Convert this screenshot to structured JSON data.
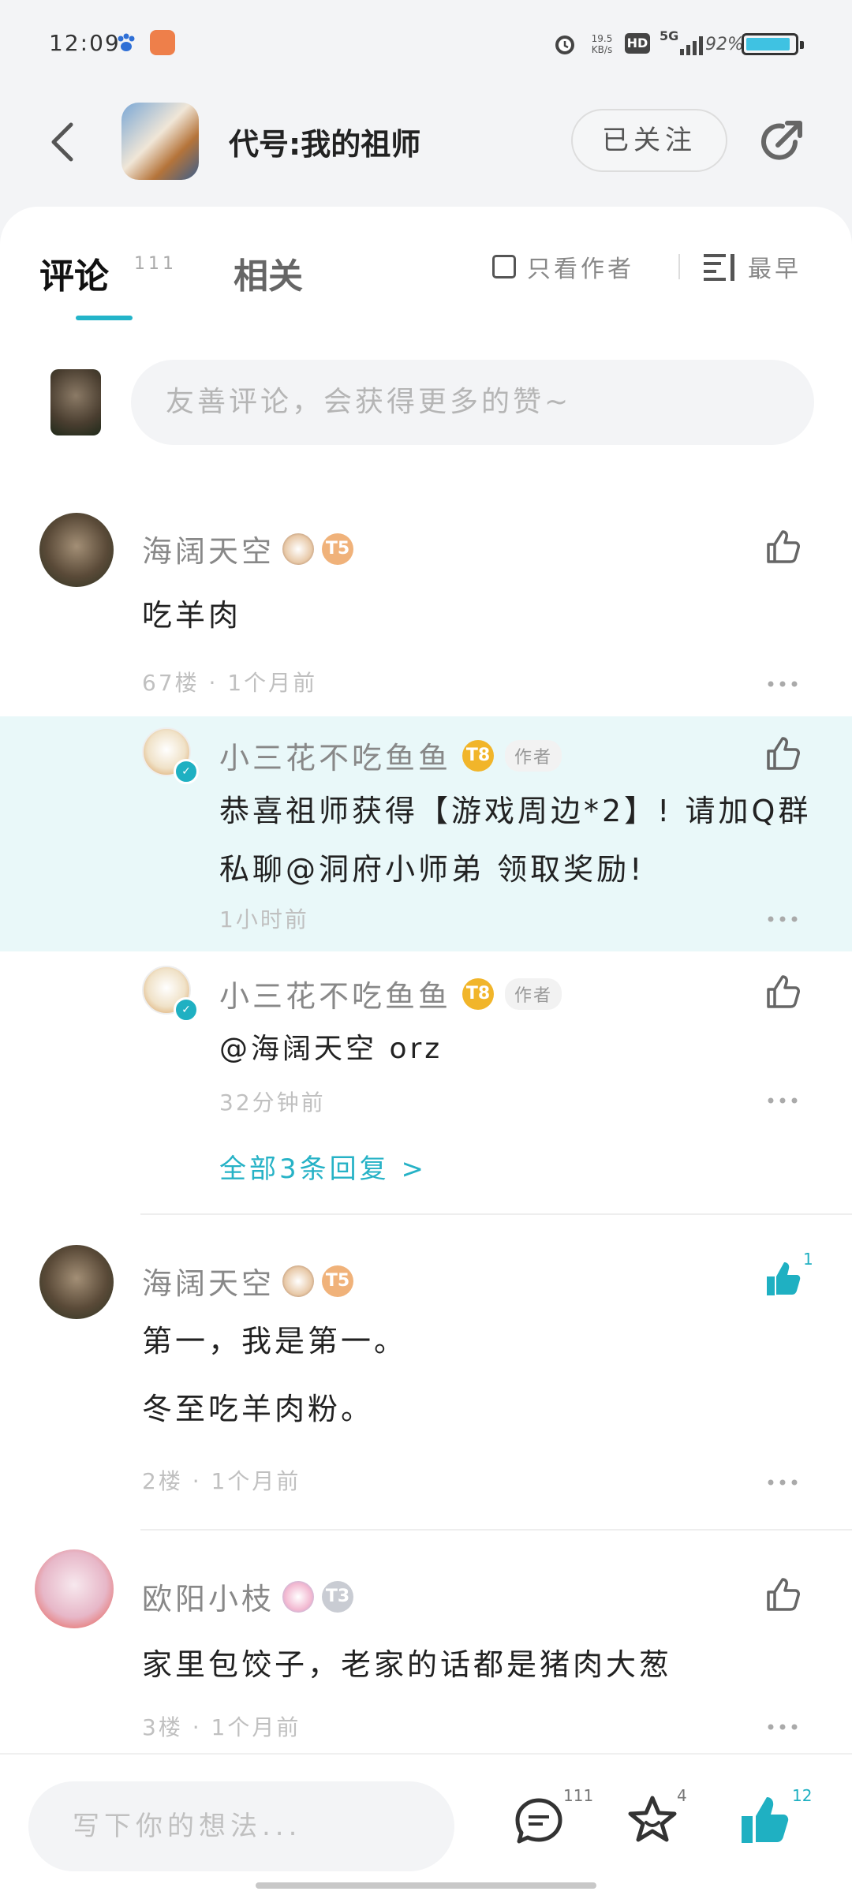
{
  "status_bar": {
    "time": "12:09",
    "net_speed_value": "19.5",
    "net_speed_unit": "KB/s",
    "hd": "HD",
    "signal": "5G",
    "battery": "92%",
    "battery_level": 0.92
  },
  "header": {
    "title": "代号:我的祖师",
    "follow_label": "已关注"
  },
  "tabs": {
    "comments_label": "评论",
    "comments_count": "111",
    "related_label": "相关",
    "only_author_label": "只看作者",
    "sort_label": "最早"
  },
  "composer": {
    "placeholder": "友善评论，会获得更多的赞~"
  },
  "comments": [
    {
      "user": "海阔天空",
      "level": "T5",
      "text": "吃羊肉",
      "meta": "67楼 · 1个月前"
    },
    {
      "user": "海阔天空",
      "level": "T5",
      "lines": [
        "第一，我是第一。",
        "冬至吃羊肉粉。"
      ],
      "meta": "2楼 · 1个月前",
      "likes": "1"
    },
    {
      "user": "欧阳小枝",
      "level": "T3",
      "text": "家里包饺子，老家的话都是猪肉大葱",
      "meta": "3楼 · 1个月前"
    }
  ],
  "replies": [
    {
      "user": "小三花不吃鱼鱼",
      "level": "T8",
      "tag": "作者",
      "lines": [
        "恭喜祖师获得【游戏周边*2】! 请加Q群",
        "私聊@洞府小师弟 领取奖励!"
      ],
      "meta": "1小时前"
    },
    {
      "user": "小三花不吃鱼鱼",
      "level": "T8",
      "tag": "作者",
      "text": "@海阔天空 orz",
      "meta": "32分钟前"
    }
  ],
  "all_replies_label": "全部3条回复 >",
  "bottom_bar": {
    "placeholder": "写下你的想法...",
    "comment_count": "111",
    "star_count": "4",
    "like_count": "12"
  },
  "colors": {
    "accent": "#23b4c9",
    "highlight_bg": "#e9f8f9",
    "battery": "#3fc2e2"
  }
}
